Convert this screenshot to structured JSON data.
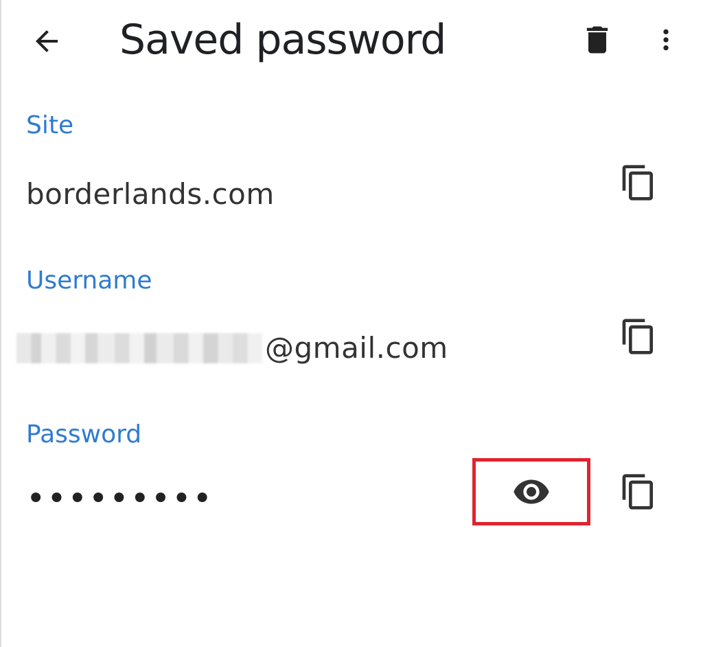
{
  "header": {
    "title": "Saved password",
    "back_icon": "arrow-back-icon",
    "delete_icon": "trash-icon",
    "more_icon": "more-vert-icon"
  },
  "site": {
    "label": "Site",
    "value": "borderlands.com",
    "copy_icon": "copy-icon"
  },
  "username": {
    "label": "Username",
    "value_suffix": "@gmail.com",
    "copy_icon": "copy-icon"
  },
  "password": {
    "label": "Password",
    "masked_value": "•••••••••",
    "reveal_icon": "eye-icon",
    "copy_icon": "copy-icon"
  },
  "colors": {
    "label_accent": "#2f7bd0",
    "highlight_border": "#e0242f",
    "icon": "#333333"
  }
}
